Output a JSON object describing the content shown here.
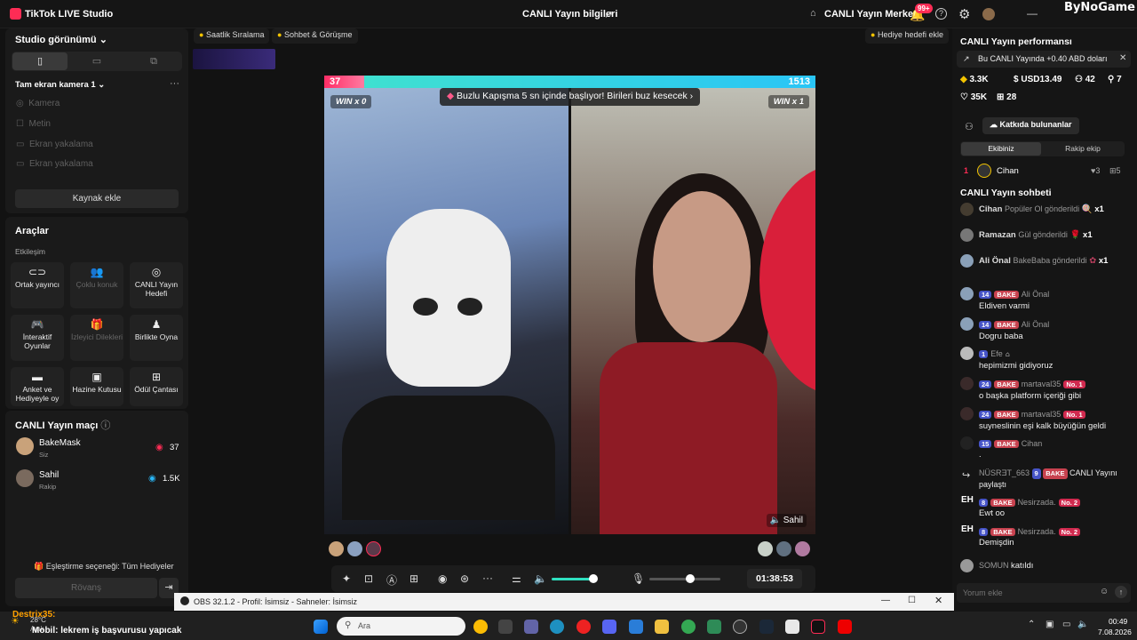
{
  "titlebar": {
    "app_title": "TikTok LIVE Studio",
    "center_title": "CANLI Yayın bilgileri",
    "center_button": "CANLI Yayın Merkezi",
    "notif_count": "99+",
    "watermark": "ByNoGame"
  },
  "left": {
    "studio_view": "Studio görünümü",
    "scene_name": "Tam ekran kamera 1",
    "sources": [
      "Kamera",
      "Metin",
      "Ekran yakalama",
      "Ekran yakalama"
    ],
    "add_source": "Kaynak ekle",
    "tools_title": "Araçlar",
    "engagement": "Etkileşim",
    "tools": [
      {
        "label": "Ortak yayıncı",
        "icon": "link-icon",
        "enabled": true
      },
      {
        "label": "Çoklu konuk",
        "icon": "users-icon",
        "enabled": false
      },
      {
        "label": "CANLI Yayın Hedefi",
        "icon": "target-icon",
        "enabled": true
      },
      {
        "label": "İnteraktif Oyunlar",
        "icon": "gamepad-icon",
        "enabled": true
      },
      {
        "label": "İzleyici Dilekleri",
        "icon": "gift-icon",
        "enabled": false
      },
      {
        "label": "Birlikte Oyna",
        "icon": "joystick-icon",
        "enabled": true
      },
      {
        "label": "Anket ve Hediyeyle oy",
        "icon": "poll-icon",
        "enabled": true
      },
      {
        "label": "Hazine Kutusu",
        "icon": "treasure-icon",
        "enabled": true
      },
      {
        "label": "Ödül Çantası",
        "icon": "bag-icon",
        "enabled": true
      }
    ],
    "match_title": "CANLI Yayın maçı",
    "players": [
      {
        "name": "BakeMask",
        "role": "Siz",
        "score": "37"
      },
      {
        "name": "Sahil",
        "role": "Rakip",
        "score": "1.5K"
      }
    ],
    "matching_option": "Eşleştirme seçeneği: Tüm Hediyeler",
    "rematch": "Rövanş"
  },
  "top_chips": {
    "ranking": "Saatlik Sıralama",
    "chat_talk": "Sohbet & Görüşme",
    "gift_goal": "Hediye hedefi ekle"
  },
  "stream": {
    "score_left": "37",
    "score_right": "1513",
    "win_left": "WIN x 0",
    "win_right": "WIN x 1",
    "banner": "Buzlu Kapışma 5 sn içinde başlıyor! Birileri buz kesecek",
    "opponent_tag": "Sahil",
    "timer": "01:38:53"
  },
  "right": {
    "perf_title": "CANLI Yayın performansı",
    "earn_msg": "Bu CANLI Yayında +0.40 ABD doları",
    "stats": {
      "likes": "3.3K",
      "usd": "USD13.49",
      "viewers": "42",
      "followers": "7",
      "hearts": "35K",
      "gifts": "28"
    },
    "contributors_btn": "Katkıda bulunanlar",
    "tab_team": "Ekibiniz",
    "tab_rival": "Rakip ekip",
    "top_contributor": {
      "rank": "1",
      "name": "Cihan",
      "likes": "3",
      "gifts": "5"
    },
    "chat_title": "CANLI Yayın sohbeti",
    "gifts": [
      {
        "user": "Cihan",
        "text": "Popüler Ol gönderildi",
        "count": "x1"
      },
      {
        "user": "Ramazan",
        "text": "Gül gönderildi",
        "count": "x1"
      },
      {
        "user": "Ali Önal",
        "text": "BakeBaba gönderildi",
        "count": "x1"
      }
    ],
    "messages": [
      {
        "level": "14",
        "fan": "BAKE",
        "user": "Ali Önal",
        "rank": "",
        "text": "Eldiven varmi"
      },
      {
        "level": "14",
        "fan": "BAKE",
        "user": "Ali Önal",
        "rank": "",
        "text": "Dogru baba"
      },
      {
        "level": "1",
        "fan": "",
        "user": "Efe",
        "rank": "",
        "text": "hepimizmi gidiyoruz"
      },
      {
        "level": "24",
        "fan": "BAKE",
        "user": "martaval35",
        "rank": "No. 1",
        "text": "o başka platform içeriği gibi"
      },
      {
        "level": "24",
        "fan": "BAKE",
        "user": "martaval35",
        "rank": "No. 1",
        "text": "suyneslinin eşi kalk büyüğün geldi"
      },
      {
        "level": "15",
        "fan": "BAKE",
        "user": "Cihan",
        "rank": "",
        "text": "."
      }
    ],
    "share_event": {
      "user": "NÜSRƎT_663",
      "level": "9",
      "fan": "BAKE",
      "text": "CANLI Yayını paylaştı"
    },
    "messages2": [
      {
        "level": "8",
        "fan": "BAKE",
        "user": "Nesirzada.",
        "rank": "No. 2",
        "text": "Ewt oo"
      },
      {
        "level": "8",
        "fan": "BAKE",
        "user": "Nesirzada.",
        "rank": "No. 2",
        "text": "Demişdin"
      }
    ],
    "join_event": {
      "user": "SOMUN",
      "text": "katıldı"
    },
    "comment_placeholder": "Yorum ekle"
  },
  "obs": {
    "title": "OBS 32.1.2 - Profil: İsimsiz - Sahneler: İsimsiz"
  },
  "taskbar": {
    "search_placeholder": "Ara",
    "weather": "28°C",
    "weather_desc": "Açık",
    "overlay_user": "Destrix35:",
    "overlay_msg": "Mobil: lekrem iş başvurusu yapıcak",
    "time": "00:49",
    "date": "7.08.2026"
  }
}
